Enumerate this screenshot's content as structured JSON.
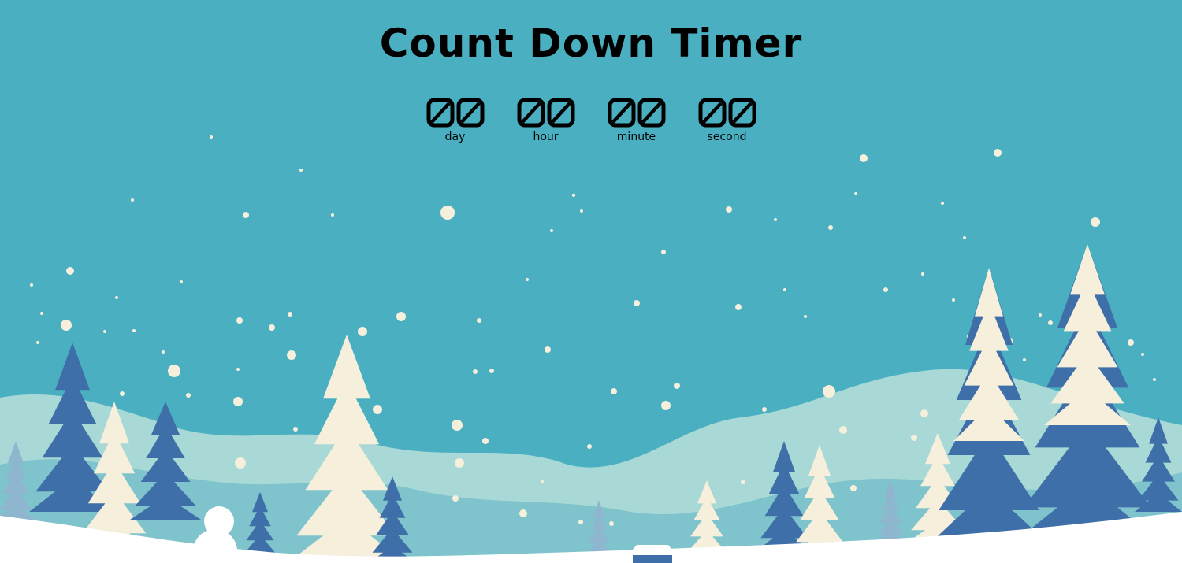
{
  "page": {
    "title": "Count Down Timer"
  },
  "timer": {
    "units": [
      {
        "key": "day",
        "value": "00",
        "label": "day"
      },
      {
        "key": "hour",
        "value": "00",
        "label": "hour"
      },
      {
        "key": "minute",
        "value": "00",
        "label": "minute"
      },
      {
        "key": "second",
        "value": "00",
        "label": "second"
      }
    ]
  },
  "colors": {
    "sky": "#4aafc1",
    "hill_light": "#a9d9d6",
    "hill_mid": "#7fc4cc",
    "tree_blue": "#3f6fa8",
    "tree_cream": "#f6efdc",
    "snow": "#ffffff",
    "text": "#000000"
  },
  "background": {
    "description_icon": "winter-forest-scene"
  }
}
